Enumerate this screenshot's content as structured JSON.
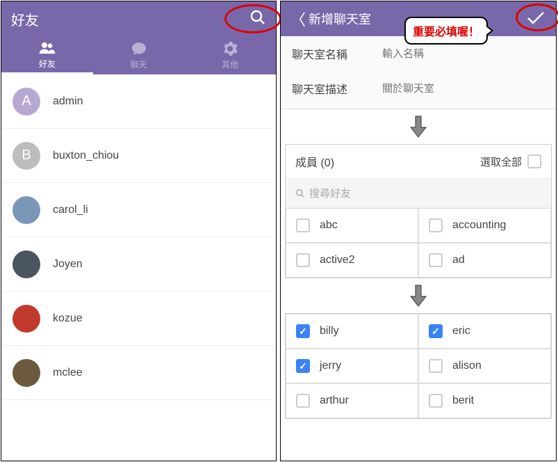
{
  "left": {
    "title": "好友",
    "tabs": [
      {
        "label": "好友",
        "icon": "friends-icon",
        "active": true
      },
      {
        "label": "聊天",
        "icon": "chat-icon",
        "active": false
      },
      {
        "label": "其他",
        "icon": "settings-icon",
        "active": false
      }
    ],
    "friends": [
      {
        "name": "admin",
        "avatar_letter": "A",
        "avatar_color": "#b7a8d1"
      },
      {
        "name": "buxton_chiou",
        "avatar_letter": "B",
        "avatar_color": "#bdbdbd"
      },
      {
        "name": "carol_li",
        "avatar_letter": "",
        "avatar_color": "#7a97b8"
      },
      {
        "name": "Joyen",
        "avatar_letter": "",
        "avatar_color": "#4a5560"
      },
      {
        "name": "kozue",
        "avatar_letter": "",
        "avatar_color": "#c0392b"
      },
      {
        "name": "mclee",
        "avatar_letter": "",
        "avatar_color": "#6b5a3e"
      }
    ]
  },
  "right": {
    "title": "新增聊天室",
    "form": {
      "name_label": "聊天室名稱",
      "name_placeholder": "輸入名稱",
      "desc_label": "聊天室描述",
      "desc_placeholder": "關於聊天室"
    },
    "members": {
      "title_prefix": "成員",
      "count": 0,
      "select_all_label": "選取全部",
      "search_placeholder": "搜尋好友",
      "group1": [
        {
          "name": "abc",
          "checked": false
        },
        {
          "name": "accounting",
          "checked": false
        },
        {
          "name": "active2",
          "checked": false
        },
        {
          "name": "ad",
          "checked": false
        }
      ],
      "group2": [
        {
          "name": "billy",
          "checked": true
        },
        {
          "name": "eric",
          "checked": true
        },
        {
          "name": "jerry",
          "checked": true
        },
        {
          "name": "alison",
          "checked": false
        },
        {
          "name": "arthur",
          "checked": false
        },
        {
          "name": "berit",
          "checked": false
        }
      ]
    }
  },
  "annotations": {
    "callout_text": "重要必填喔！"
  },
  "colors": {
    "brand": "#7868aa",
    "accent_blue": "#3b82f6",
    "alert_red": "#d00000"
  }
}
